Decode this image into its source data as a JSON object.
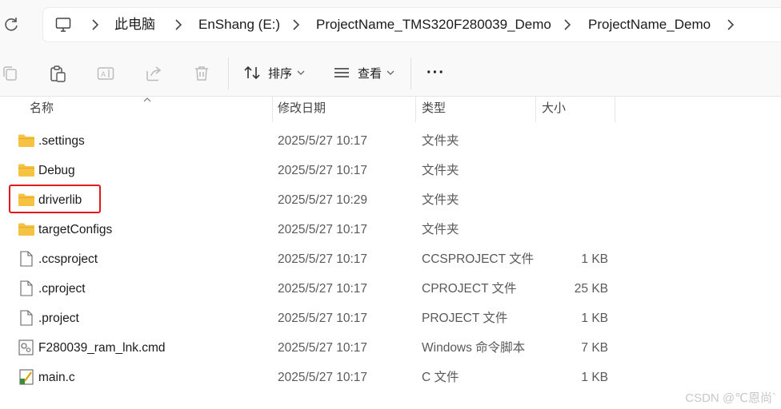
{
  "address_bar": {
    "crumbs": [
      "此电脑",
      "EnShang (E:)",
      "ProjectName_TMS320F280039_Demo",
      "ProjectName_Demo"
    ]
  },
  "toolbar": {
    "sort_label": "排序",
    "view_label": "查看",
    "more_label": "···"
  },
  "columns": {
    "name": "名称",
    "date": "修改日期",
    "type": "类型",
    "size": "大小"
  },
  "files": [
    {
      "name": ".settings",
      "date": "2025/5/27 10:17",
      "type": "文件夹",
      "size": "",
      "icon": "folder-icon"
    },
    {
      "name": "Debug",
      "date": "2025/5/27 10:17",
      "type": "文件夹",
      "size": "",
      "icon": "folder-icon"
    },
    {
      "name": "driverlib",
      "date": "2025/5/27 10:29",
      "type": "文件夹",
      "size": "",
      "icon": "folder-icon"
    },
    {
      "name": "targetConfigs",
      "date": "2025/5/27 10:17",
      "type": "文件夹",
      "size": "",
      "icon": "folder-icon"
    },
    {
      "name": ".ccsproject",
      "date": "2025/5/27 10:17",
      "type": "CCSPROJECT 文件",
      "size": "1 KB",
      "icon": "file-icon"
    },
    {
      "name": ".cproject",
      "date": "2025/5/27 10:17",
      "type": "CPROJECT 文件",
      "size": "25 KB",
      "icon": "file-icon"
    },
    {
      "name": ".project",
      "date": "2025/5/27 10:17",
      "type": "PROJECT 文件",
      "size": "1 KB",
      "icon": "file-icon"
    },
    {
      "name": "F280039_ram_lnk.cmd",
      "date": "2025/5/27 10:17",
      "type": "Windows 命令脚本",
      "size": "7 KB",
      "icon": "cmd-script-icon"
    },
    {
      "name": "main.c",
      "date": "2025/5/27 10:17",
      "type": "C 文件",
      "size": "1 KB",
      "icon": "c-source-icon"
    }
  ],
  "watermark": "CSDN @℃恩尚`",
  "colors": {
    "highlight": "#e0191c",
    "folder": "#f6c242"
  }
}
